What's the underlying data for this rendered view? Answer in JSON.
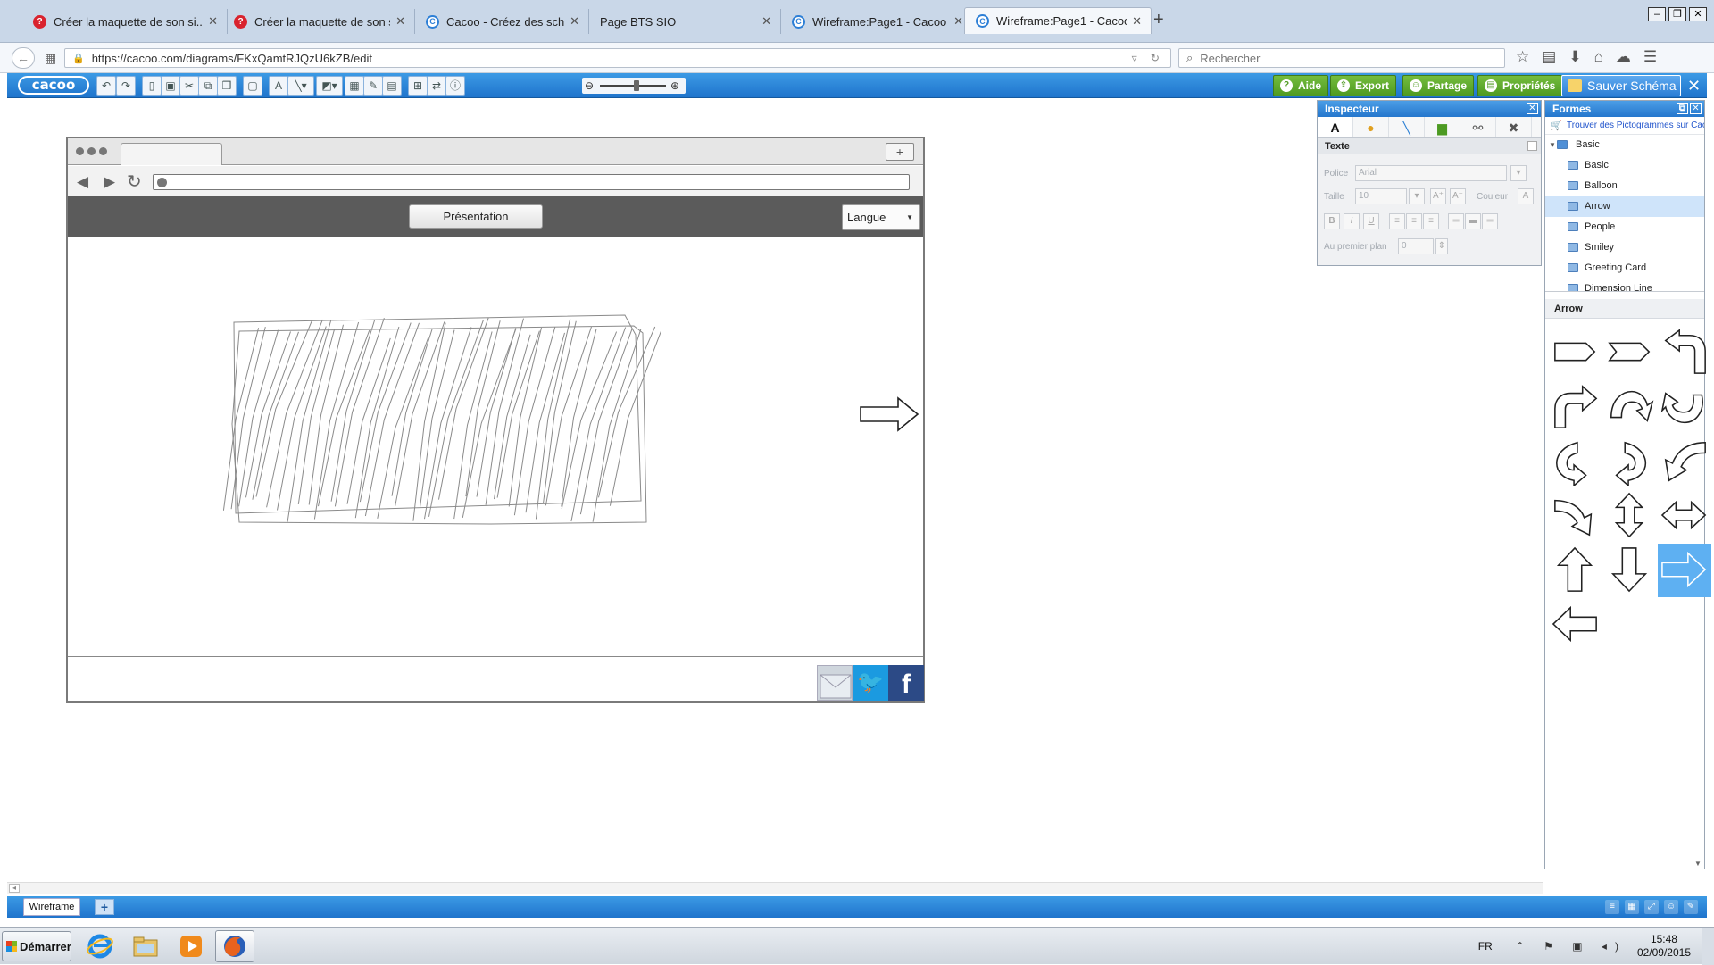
{
  "browser": {
    "tabs": [
      {
        "title": "Créer la maquette de son si...",
        "icon": "question-icon",
        "active": false
      },
      {
        "title": "Créer la maquette de son si...",
        "icon": "question-icon",
        "active": false
      },
      {
        "title": "Cacoo - Créez des schéma...",
        "icon": "cacoo-icon",
        "active": false
      },
      {
        "title": "Page BTS SIO",
        "icon": "none",
        "active": false
      },
      {
        "title": "Wireframe:Page1 - Cacoo",
        "icon": "cacoo-icon",
        "active": false
      },
      {
        "title": "Wireframe:Page1 - Cacoo",
        "icon": "cacoo-icon",
        "active": true
      }
    ],
    "url": "https://cacoo.com/diagrams/FKxQamtRJQzU6kZB/edit",
    "search_placeholder": "Rechercher"
  },
  "cacoo": {
    "logo": "cacoo",
    "buttons": {
      "aide": "Aide",
      "export": "Export",
      "partage": "Partage",
      "proprietes": "Propriétés",
      "save": "Sauver Schéma"
    },
    "zoom_level_percent": 55
  },
  "mockup": {
    "presentation_button": "Présentation",
    "language_select": "Langue"
  },
  "inspector": {
    "title": "Inspecteur",
    "tab_text_label": "A",
    "section": "Texte",
    "font_label": "Police",
    "font_value": "Arial",
    "size_label": "Taille",
    "size_value": "10",
    "color_label": "Couleur",
    "foreground_label": "Au premier plan",
    "foreground_value": "0"
  },
  "shapes": {
    "title": "Formes",
    "find_link": "Trouver des Pictogrammes sur Cacoo",
    "tree": [
      {
        "label": "Basic",
        "root": true,
        "selected": false
      },
      {
        "label": "Basic",
        "root": false,
        "selected": false
      },
      {
        "label": "Balloon",
        "root": false,
        "selected": false
      },
      {
        "label": "Arrow",
        "root": false,
        "selected": true
      },
      {
        "label": "People",
        "root": false,
        "selected": false
      },
      {
        "label": "Smiley",
        "root": false,
        "selected": false
      },
      {
        "label": "Greeting Card",
        "root": false,
        "selected": false
      },
      {
        "label": "Dimension Line",
        "root": false,
        "selected": false
      }
    ],
    "category": "Arrow",
    "items": [
      "pentagon-arrow",
      "chevron-arrow",
      "u-turn-left-arrow",
      "bent-up-right-arrow",
      "curved-up-arrow",
      "curved-down-arrow",
      "curved-left-arrow",
      "curved-right-arrow",
      "curved-up-left-arrow",
      "curved-down-right-arrow",
      "up-down-arrow",
      "left-right-arrow",
      "up-arrow",
      "down-arrow",
      "right-arrow",
      "left-arrow"
    ],
    "selected_item": "right-arrow"
  },
  "sheet": {
    "tab": "Wireframe"
  },
  "taskbar": {
    "start": "Démarrer",
    "lang": "FR",
    "time": "15:48",
    "date": "02/09/2015"
  },
  "colors": {
    "cacoo_blue": "#2577cd",
    "green_button": "#5aa62a",
    "selection_blue": "#5eb0f2"
  }
}
